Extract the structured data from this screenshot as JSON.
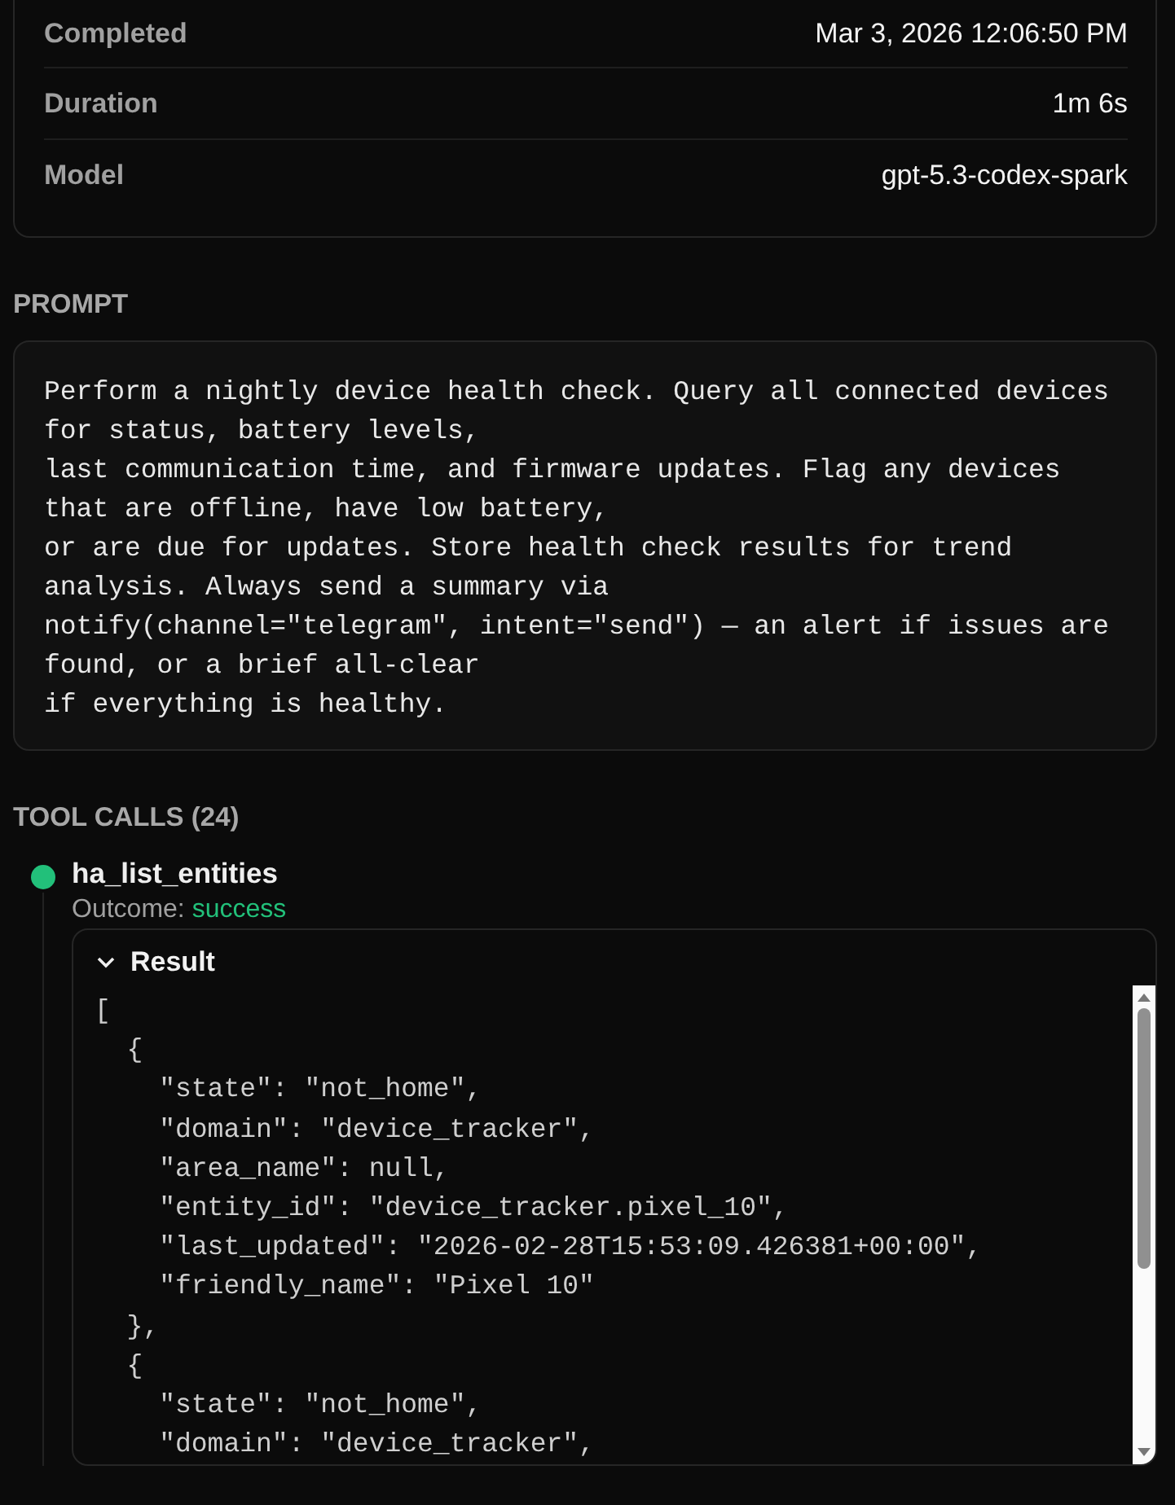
{
  "details": [
    {
      "label": "Completed",
      "value": "Mar 3, 2026 12:06:50 PM"
    },
    {
      "label": "Duration",
      "value": "1m 6s"
    },
    {
      "label": "Model",
      "value": "gpt-5.3-codex-spark"
    }
  ],
  "prompt": {
    "heading": "PROMPT",
    "text": "Perform a nightly device health check. Query all connected devices for status, battery levels,\nlast communication time, and firmware updates. Flag any devices that are offline, have low battery,\nor are due for updates. Store health check results for trend analysis. Always send a summary via\nnotify(channel=\"telegram\", intent=\"send\") — an alert if issues are found, or a brief all-clear\nif everything is healthy."
  },
  "tool_calls": {
    "heading": "TOOL CALLS (24)",
    "items": [
      {
        "name": "ha_list_entities",
        "outcome_label": "Outcome:",
        "outcome": "success",
        "color": "#22c07a",
        "result": {
          "title": "Result",
          "expanded": true,
          "lines": [
            "[",
            "  {",
            "    \"state\": \"not_home\",",
            "    \"domain\": \"device_tracker\",",
            "    \"area_name\": null,",
            "    \"entity_id\": \"device_tracker.pixel_10\",",
            "    \"last_updated\": \"2026-02-28T15:53:09.426381+00:00\",",
            "    \"friendly_name\": \"Pixel 10\"",
            "  },",
            "  {",
            "    \"state\": \"not_home\",",
            "    \"domain\": \"device_tracker\","
          ]
        }
      }
    ]
  }
}
